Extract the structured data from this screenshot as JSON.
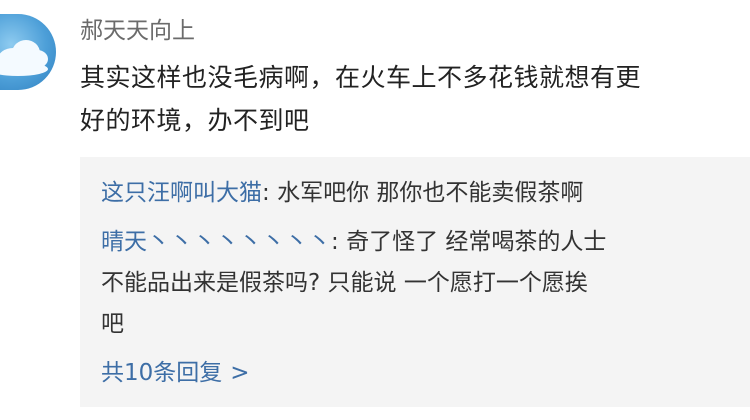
{
  "comment": {
    "username": "郝天天向上",
    "content_lines": [
      "其实这样也没毛病啊，在火车上不多花钱就想有更",
      "好的环境，办不到吧"
    ]
  },
  "replies": [
    {
      "name": "这只汪啊叫大猫",
      "separator": ": ",
      "lines": [
        "水军吧你 那你也不能卖假茶啊"
      ]
    },
    {
      "name": "晴天丶丶丶丶丶丶丶丶",
      "separator": ": ",
      "lines": [
        "奇了怪了 经常喝茶的人士",
        "不能品出来是假茶吗? 只能说 一个愿打一个愿挨",
        "吧"
      ]
    }
  ],
  "more_replies": {
    "label": "共10条回复",
    "icon": "chevron-right-icon",
    "glyph": ">"
  },
  "colors": {
    "username": "#6b6b6b",
    "text": "#222222",
    "link": "#3d6ea6",
    "reply_bg": "#f4f4f4"
  }
}
